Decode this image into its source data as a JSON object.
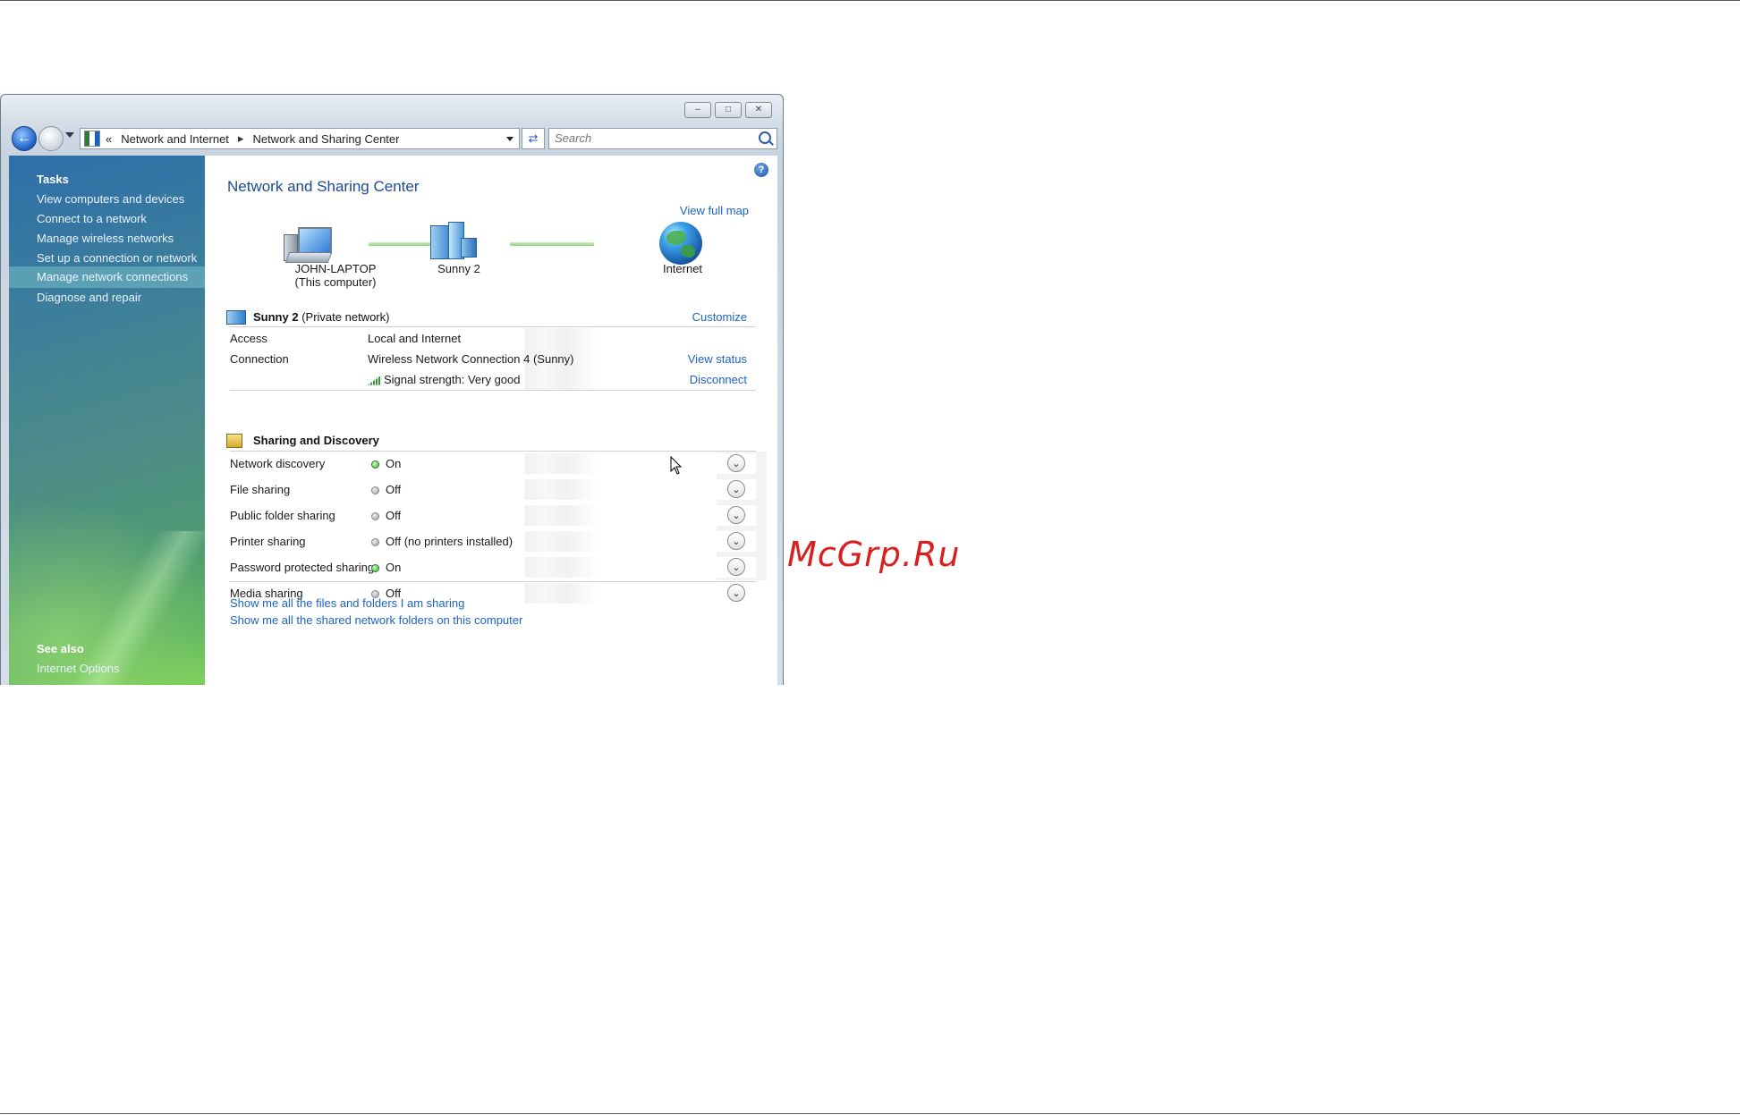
{
  "window": {
    "address": {
      "prefix": "«",
      "crumbs": [
        "Network and Internet",
        "Network and Sharing Center"
      ],
      "separator": "▸"
    },
    "search": {
      "placeholder": "Search"
    }
  },
  "sidebar": {
    "tasks_heading": "Tasks",
    "items": [
      "View computers and devices",
      "Connect to a network",
      "Manage wireless networks",
      "Set up a connection or network",
      "Manage network connections",
      "Diagnose and repair"
    ],
    "see_also_heading": "See also",
    "see_also_items": [
      "Internet Options"
    ]
  },
  "main": {
    "title": "Network and Sharing Center",
    "view_full_map": "View full map",
    "map": {
      "computer_name": "JOHN-LAPTOP",
      "computer_sub": "(This computer)",
      "network_name": "Sunny  2",
      "internet": "Internet"
    },
    "network_section": {
      "name": "Sunny  2",
      "type": "(Private network)",
      "customize": "Customize",
      "rows": {
        "access_label": "Access",
        "access_value": "Local and Internet",
        "connection_label": "Connection",
        "connection_value": "Wireless Network Connection 4 (Sunny)",
        "view_status": "View status",
        "signal_value": "Signal strength:  Very good",
        "disconnect": "Disconnect"
      }
    },
    "sharing_section": {
      "title": "Sharing and Discovery",
      "rows": [
        {
          "label": "Network discovery",
          "value": "On",
          "state": "on"
        },
        {
          "label": "File sharing",
          "value": "Off",
          "state": "off"
        },
        {
          "label": "Public folder sharing",
          "value": "Off",
          "state": "off"
        },
        {
          "label": "Printer sharing",
          "value": "Off (no printers installed)",
          "state": "off"
        },
        {
          "label": "Password protected sharing",
          "value": "On",
          "state": "on"
        },
        {
          "label": "Media sharing",
          "value": "Off",
          "state": "off"
        }
      ]
    },
    "bottom_links": [
      "Show me all the files and folders I am sharing",
      "Show me all the shared network folders on this computer"
    ]
  },
  "watermark": "McGrp.Ru",
  "colors": {
    "link": "#1c63c2",
    "title": "#1e4a93",
    "status_on": "#3bb03b",
    "watermark": "#d91f1f"
  }
}
